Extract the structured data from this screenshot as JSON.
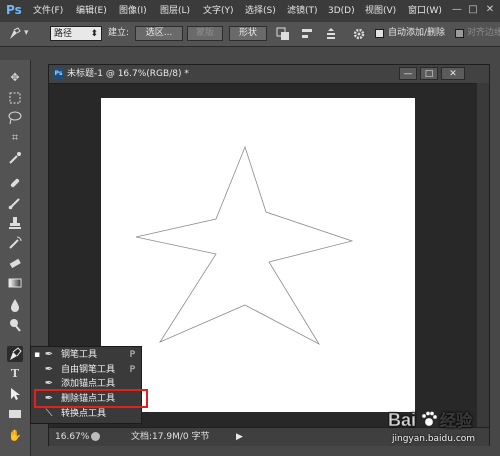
{
  "app": {
    "logo": "Ps"
  },
  "menubar": {
    "items": [
      "文件(F)",
      "编辑(E)",
      "图像(I)",
      "图层(L)",
      "文字(Y)",
      "选择(S)",
      "滤镜(T)",
      "3D(D)",
      "视图(V)",
      "窗口(W)"
    ],
    "window_controls": [
      "—",
      "□",
      "✕"
    ]
  },
  "options": {
    "mode_value": "路径",
    "make_label": "建立:",
    "selection_button": "选区...",
    "mask_button": "蒙版",
    "shape_button": "形状",
    "auto_add_delete_label": "自动添加/删除",
    "align_edges_label": "对齐边缘"
  },
  "document": {
    "title": "未标题-1 @ 16.7%(RGB/8) *",
    "controls": [
      "—",
      "□",
      "✕"
    ],
    "zoom": "16.67%",
    "doc_info": "文档:17.9M/0 字节"
  },
  "flyout": {
    "items": [
      {
        "label": "钢笔工具",
        "shortcut": "P",
        "active": true
      },
      {
        "label": "自由钢笔工具",
        "shortcut": "P",
        "active": false
      },
      {
        "label": "添加锚点工具",
        "shortcut": "",
        "active": false
      },
      {
        "label": "删除锚点工具",
        "shortcut": "",
        "active": false
      },
      {
        "label": "转换点工具",
        "shortcut": "",
        "active": false
      }
    ]
  },
  "watermark": {
    "logo": "Bai度经验",
    "url": "jingyan.baidu.com"
  },
  "colors": {
    "highlight": "#e2211c",
    "accent": "#6fb7ff"
  },
  "icons": {
    "toolbar": [
      "move-icon",
      "marquee-icon",
      "lasso-icon",
      "crop-icon",
      "eyedropper-icon",
      "healing-brush-icon",
      "brush-icon",
      "clone-stamp-icon",
      "history-brush-icon",
      "eraser-icon",
      "gradient-icon",
      "blur-icon",
      "dodge-icon",
      "pen-icon",
      "type-icon",
      "path-selection-icon",
      "rectangle-icon",
      "hand-icon"
    ]
  }
}
